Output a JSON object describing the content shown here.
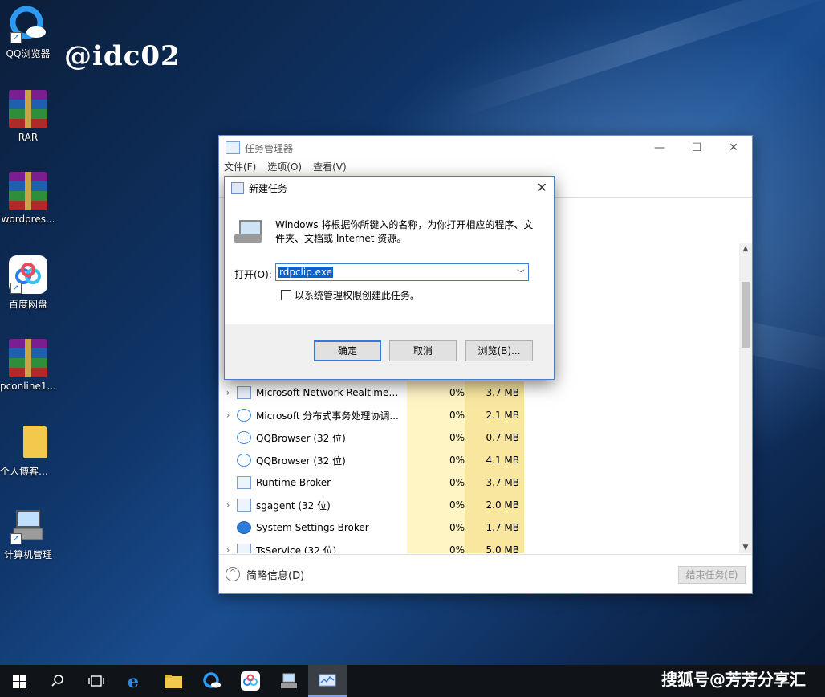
{
  "watermark_top": "@idc02",
  "watermark_bottom": "搜狐号@芳芳分享汇",
  "desktop_icons": [
    {
      "label": "QQ浏览器"
    },
    {
      "label": "RAR"
    },
    {
      "label": "wordpres..."
    },
    {
      "label": "百度网盘"
    },
    {
      "label": "pconline1..."
    },
    {
      "label": "个人博客网站"
    },
    {
      "label": "计算机管理"
    }
  ],
  "task_manager": {
    "title": "任务管理器",
    "menu": [
      "文件(F)",
      "选项(O)",
      "查看(V)"
    ],
    "processes": [
      {
        "name": "Microsoft Network Realtime ...",
        "cpu": "0%",
        "mem": "3.7 MB"
      },
      {
        "name": "Microsoft 分布式事务处理协调...",
        "cpu": "0%",
        "mem": "2.1 MB"
      },
      {
        "name": "QQBrowser (32 位)",
        "cpu": "0%",
        "mem": "0.7 MB"
      },
      {
        "name": "QQBrowser (32 位)",
        "cpu": "0%",
        "mem": "4.1 MB"
      },
      {
        "name": "Runtime Broker",
        "cpu": "0%",
        "mem": "3.7 MB"
      },
      {
        "name": "sgagent (32 位)",
        "cpu": "0%",
        "mem": "2.0 MB"
      },
      {
        "name": "System Settings Broker",
        "cpu": "0%",
        "mem": "1.7 MB"
      },
      {
        "name": "TsService (32 位)",
        "cpu": "0%",
        "mem": "5.0 MB"
      }
    ],
    "fewer_details": "简略信息(D)",
    "end_task": "结束任务(E)"
  },
  "run_dialog": {
    "title": "新建任务",
    "description": "Windows 将根据你所键入的名称，为你打开相应的程序、文件夹、文档或 Internet 资源。",
    "open_label": "打开(O):",
    "input_value": "rdpclip.exe",
    "checkbox_label": "以系统管理权限创建此任务。",
    "ok": "确定",
    "cancel": "取消",
    "browse": "浏览(B)..."
  }
}
